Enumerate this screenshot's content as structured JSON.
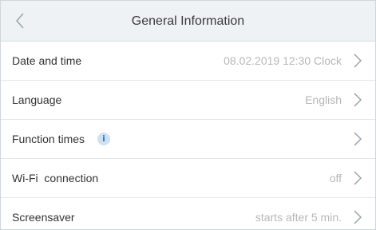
{
  "header": {
    "title": "General Information",
    "back_icon": "chevron-left-icon"
  },
  "rows": [
    {
      "label": "Date and time",
      "value": "08.02.2019 12:30 Clock"
    },
    {
      "label": "Language",
      "value": "English"
    },
    {
      "label": "Function times",
      "info_glyph": "i",
      "value": ""
    },
    {
      "label": "Wi-Fi  connection",
      "value": "off"
    },
    {
      "label": "Screensaver",
      "value": "starts after 5 min."
    }
  ],
  "colors": {
    "header_bg": "#eef2f5",
    "label_text": "#333333",
    "value_text": "#b7b7b7",
    "info_accent": "#2e7bc4"
  }
}
